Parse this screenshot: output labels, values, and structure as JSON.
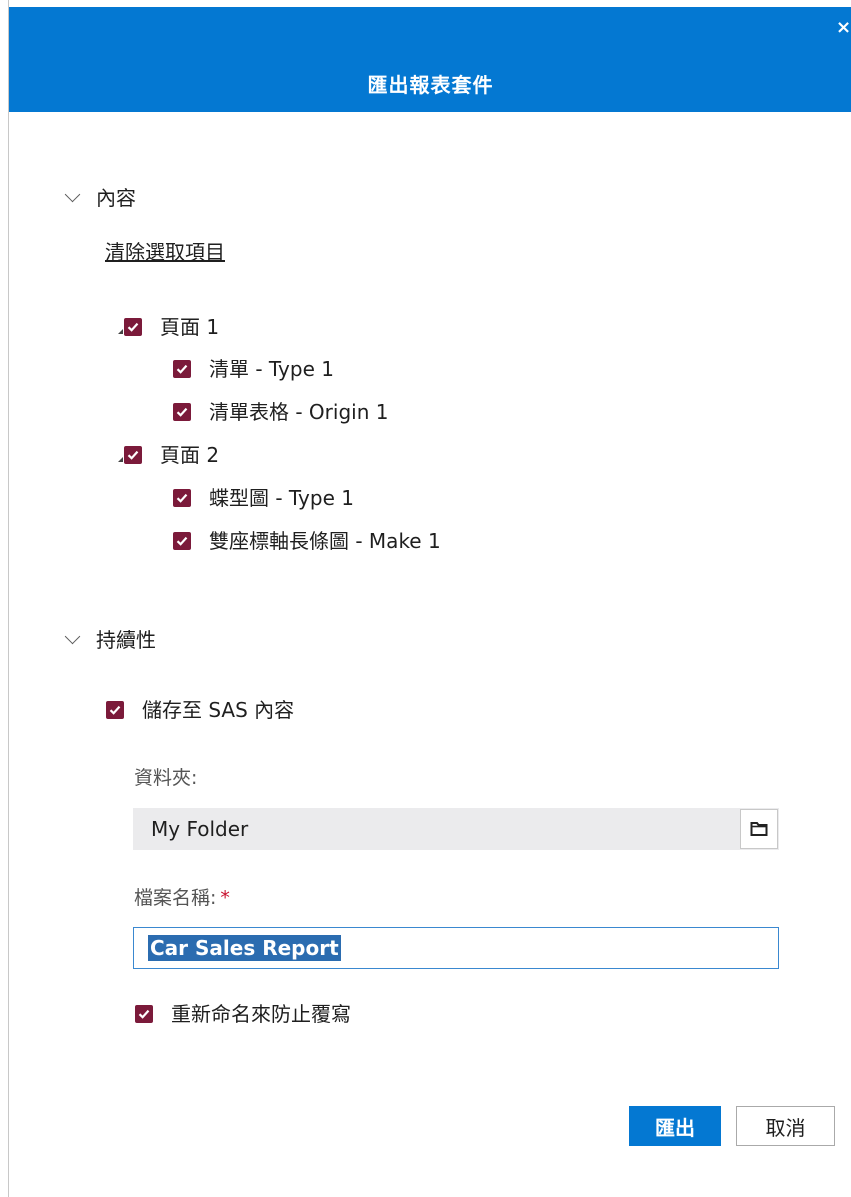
{
  "dialog": {
    "title": "匯出報表套件",
    "close_label": "×"
  },
  "content_section": {
    "header": "內容",
    "clear_selection": "清除選取項目",
    "tree": [
      {
        "label": "頁面 1",
        "checked": true,
        "children": [
          {
            "label": "清單 - Type 1",
            "checked": true
          },
          {
            "label": "清單表格 - Origin 1",
            "checked": true
          }
        ]
      },
      {
        "label": "頁面 2",
        "checked": true,
        "children": [
          {
            "label": "蝶型圖 - Type 1",
            "checked": true
          },
          {
            "label": "雙座標軸長條圖 - Make 1",
            "checked": true
          }
        ]
      }
    ]
  },
  "persistence_section": {
    "header": "持續性",
    "save_to_sas": {
      "label": "儲存至 SAS 內容",
      "checked": true
    },
    "folder": {
      "label": "資料夾:",
      "value": "My Folder"
    },
    "filename": {
      "label": "檔案名稱:",
      "required_marker": "*",
      "value": "Car Sales Report"
    },
    "rename_prevent_overwrite": {
      "label": "重新命名來防止覆寫",
      "checked": true
    }
  },
  "buttons": {
    "export": "匯出",
    "cancel": "取消"
  },
  "colors": {
    "header_bg": "#0478d2",
    "checkbox": "#7b1a3a",
    "primary_button": "#0478d2",
    "required": "#c8102e"
  }
}
